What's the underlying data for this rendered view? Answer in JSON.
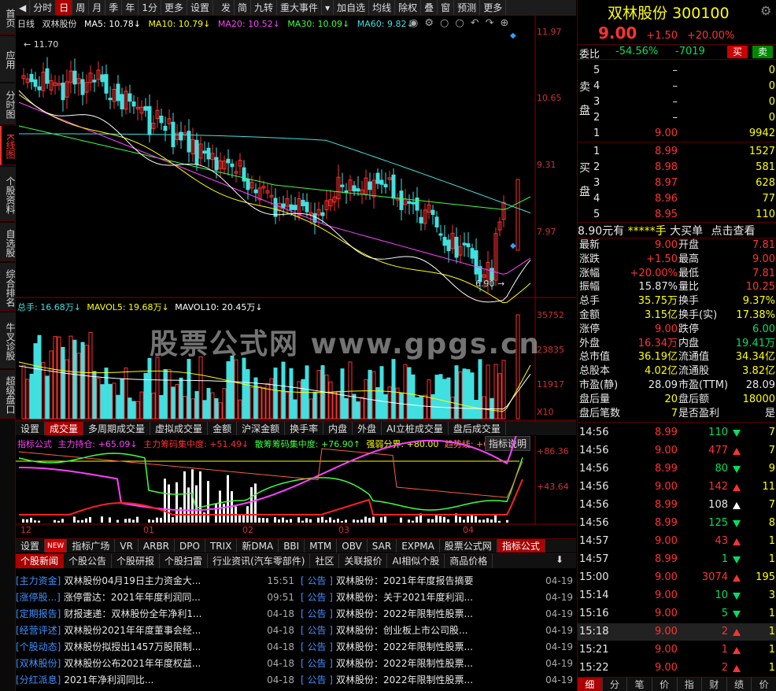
{
  "left_tabs": [
    "首页",
    "应用",
    "分时图",
    "K线图",
    "个股资料",
    "自选股",
    "综合排名",
    "牛叉诊股",
    "超级盘口"
  ],
  "toolbar": {
    "items": [
      "分时",
      "日",
      "周",
      "月",
      "季",
      "年",
      "1分",
      "更多",
      "设置",
      "发",
      "简",
      "九转",
      "重大事件",
      "加自选",
      "均线",
      "除权",
      "叠",
      "窗",
      "预测",
      "更多"
    ],
    "selected": "日"
  },
  "ma_line": {
    "period": "日线",
    "name": "双林股份",
    "ma5": "MA5: 10.78↓",
    "ma10": "MA10: 10.79↓",
    "ma20": "MA20: 10.52↓",
    "ma30": "MA30: 10.09↓",
    "ma60": "MA60: 9.82↓"
  },
  "price_axis": [
    "11.97",
    "10.65",
    "9.31",
    "7.97"
  ],
  "high_label": "11.70",
  "low_label": "6.90",
  "vol_line": {
    "total": "总手: 16.68万↓",
    "mavol5": "MAVOL5: 19.68万↓",
    "mavol10": "MAVOL10: 20.45万↓"
  },
  "vol_axis": [
    "35752",
    "23835",
    "11917",
    "X10"
  ],
  "watermark": "股票公式网  www.gpgs.cn",
  "vol_tabs": [
    "设置",
    "成交量",
    "多周期成交量",
    "虚拟成交量",
    "金额",
    "沪深金额",
    "换手率",
    "内盘",
    "外盘",
    "AI立桩成交量",
    "盘后成交量"
  ],
  "vol_tab_selected": "成交量",
  "indicator_line": {
    "name": "指标公式",
    "main": "主力持仓: +65.09↓",
    "chip": "主力筹码集中度: +51.49↓",
    "scatter": "散筹筹码集中度: +76.90↑",
    "strong": "强弱分界: +80.00",
    "trend": "趋势线: +64",
    "help": "指标说明"
  },
  "ind_axis": [
    "+86.36",
    "+43.64"
  ],
  "months": [
    "12",
    "01",
    "02",
    "03",
    "04"
  ],
  "ind_tabs": [
    "设置",
    "NEW",
    "指标广场",
    "VR",
    "ARBR",
    "DPO",
    "TRIX",
    "新DMA",
    "BBI",
    "MTM",
    "OBV",
    "SAR",
    "EXPMA",
    "股票公式网",
    "指标公式"
  ],
  "news_tabs": [
    "个股新闻",
    "个股公告",
    "个股研报",
    "个股扫雷",
    "行业资讯(汽车零部件)",
    "社区",
    "关联报价",
    "AI相似个股",
    "商品价格"
  ],
  "news_left": [
    {
      "tag": "[主力资金]",
      "title": "双林股份04月19日主力资金大...",
      "time": "15:51"
    },
    {
      "tag": "[涨停股...]",
      "title": "涨停雷达：2021年年度利润同...",
      "time": "09:51"
    },
    {
      "tag": "[定期报告]",
      "title": "财报速递：双林股份全年净利1...",
      "time": "04-18"
    },
    {
      "tag": "[经营评述]",
      "title": "双林股份2021年年度董事会经...",
      "time": "04-18"
    },
    {
      "tag": "[个股动态]",
      "title": "双林股份拟授出1457万股限制...",
      "time": "04-18"
    },
    {
      "tag": "[双林股份]",
      "title": "双林股份公布2021年年度权益...",
      "time": "04-18"
    },
    {
      "tag": "[分红派息]",
      "title": "2021年净利润同比...",
      "time": "04-18"
    }
  ],
  "news_right": [
    {
      "tag": "[  公告  ]",
      "title": "双林股份：2021年年度报告摘要",
      "time": "04-19"
    },
    {
      "tag": "[  公告  ]",
      "title": "双林股份：关于2021年度利润...",
      "time": "04-19"
    },
    {
      "tag": "[  公告  ]",
      "title": "双林股份：2022年限制性股票...",
      "time": "04-19"
    },
    {
      "tag": "[  公告  ]",
      "title": "双林股份：创业板上市公司股...",
      "time": "04-19"
    },
    {
      "tag": "[  公告  ]",
      "title": "双林股份：2022年限制性股票...",
      "time": "04-19"
    },
    {
      "tag": "[  公告  ]",
      "title": "双林股份：2022年限制性股票...",
      "time": "04-19"
    },
    {
      "tag": "[  公告  ]",
      "title": "双林股份：2022年限制性股票...",
      "time": "04-19"
    }
  ],
  "quote": {
    "name": "双林股份",
    "code": "300100",
    "price": "9.00",
    "change": "+1.50",
    "pct": "+20.00%",
    "weibi_label": "委比",
    "weibi": "-54.56%",
    "weicha": "-7019",
    "buy_btn": "买",
    "sell_btn": "卖",
    "sell_label": "卖盘",
    "buy_label": "买盘",
    "asks": [
      {
        "lvl": "5",
        "price": "–",
        "vol": "0"
      },
      {
        "lvl": "4",
        "price": "–",
        "vol": "0"
      },
      {
        "lvl": "3",
        "price": "–",
        "vol": "0"
      },
      {
        "lvl": "2",
        "price": "–",
        "vol": "0"
      },
      {
        "lvl": "1",
        "price": "9.00",
        "vol": "9942"
      }
    ],
    "bids": [
      {
        "lvl": "1",
        "price": "8.99",
        "vol": "1527"
      },
      {
        "lvl": "2",
        "price": "8.98",
        "vol": "581"
      },
      {
        "lvl": "3",
        "price": "8.97",
        "vol": "628"
      },
      {
        "lvl": "4",
        "price": "8.96",
        "vol": "77"
      },
      {
        "lvl": "5",
        "price": "8.95",
        "vol": "110"
      }
    ],
    "bigorder": {
      "a": "8.90元有",
      "b": "*****手",
      "c": "大买单",
      "d": "点击查看"
    },
    "stats": [
      {
        "k1": "最新",
        "v1": "9.00",
        "k2": "开盘",
        "v2": "7.81"
      },
      {
        "k1": "涨跌",
        "v1": "+1.50",
        "k2": "最高",
        "v2": "9.00"
      },
      {
        "k1": "涨幅",
        "v1": "+20.00%",
        "k2": "最低",
        "v2": "7.81"
      },
      {
        "k1": "振幅",
        "v1": "15.87%",
        "k2": "量比",
        "v2": "10.25"
      },
      {
        "k1": "总手",
        "v1": "35.75万",
        "k2": "换手",
        "v2": "9.37%"
      },
      {
        "k1": "金额",
        "v1": "3.15亿",
        "k2": "换手(实)",
        "v2": "17.38%"
      },
      {
        "k1": "涨停",
        "v1": "9.00",
        "k2": "跌停",
        "v2": "6.00"
      },
      {
        "k1": "外盘",
        "v1": "16.34万",
        "k2": "内盘",
        "v2": "19.41万"
      },
      {
        "k1": "总市值",
        "v1": "36.19亿",
        "k2": "流通值",
        "v2": "34.34亿"
      },
      {
        "k1": "总股本",
        "v1": "4.02亿",
        "k2": "流通股",
        "v2": "3.82亿"
      },
      {
        "k1": "市盈(静)",
        "v1": "28.09",
        "k2": "市盈(TTM)",
        "v2": "28.09"
      },
      {
        "k1": "盘后量",
        "v1": "20",
        "k2": "盘后额",
        "v2": "18000"
      },
      {
        "k1": "盘后笔数",
        "v1": "7",
        "k2": "是否盈利",
        "v2": "是"
      }
    ],
    "ticks": [
      {
        "t": "14:56",
        "p": "8.99",
        "v": "110",
        "d": "dn",
        "n": "7"
      },
      {
        "t": "14:56",
        "p": "9.00",
        "v": "477",
        "d": "up",
        "n": "7"
      },
      {
        "t": "14:56",
        "p": "8.99",
        "v": "80",
        "d": "dn",
        "n": "9"
      },
      {
        "t": "14:56",
        "p": "9.00",
        "v": "142",
        "d": "up",
        "n": "11"
      },
      {
        "t": "14:56",
        "p": "8.99",
        "v": "108",
        "d": "wh",
        "n": "7"
      },
      {
        "t": "14:56",
        "p": "8.99",
        "v": "125",
        "d": "dn",
        "n": "8"
      },
      {
        "t": "14:57",
        "p": "9.00",
        "v": "43",
        "d": "up",
        "n": "1"
      },
      {
        "t": "14:57",
        "p": "8.99",
        "v": "1",
        "d": "dn",
        "n": "1"
      },
      {
        "t": "15:00",
        "p": "9.00",
        "v": "3074",
        "d": "up",
        "n": "195"
      },
      {
        "t": "15:14",
        "p": "9.00",
        "v": "10",
        "d": "dn",
        "n": "3"
      },
      {
        "t": "15:16",
        "p": "9.00",
        "v": "5",
        "d": "dn",
        "n": "1"
      },
      {
        "t": "15:18",
        "p": "9.00",
        "v": "2",
        "d": "up",
        "n": "1"
      },
      {
        "t": "15:21",
        "p": "9.00",
        "v": "1",
        "d": "up",
        "n": "1"
      },
      {
        "t": "15:22",
        "p": "9.00",
        "v": "2",
        "d": "up",
        "n": "1"
      }
    ],
    "bottom_tabs": [
      "细",
      "分",
      "笔",
      "价",
      "指",
      "财",
      "绩",
      "价"
    ]
  }
}
